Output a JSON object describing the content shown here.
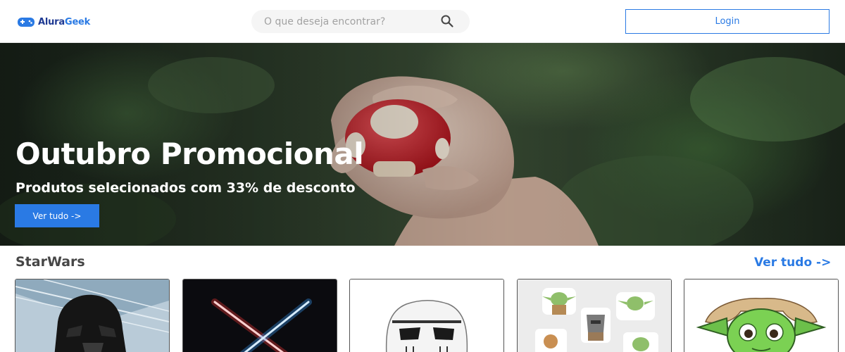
{
  "header": {
    "logo": {
      "name_part1": "Alura",
      "name_part2": "Geek",
      "icon": "gamepad-icon"
    },
    "search": {
      "placeholder": "O que deseja encontrar?",
      "icon": "search-icon"
    },
    "login_label": "Login"
  },
  "hero": {
    "title": "Outubro Promocional",
    "subtitle": "Produtos selecionados com 33% de desconto",
    "button_label": "Ver tudo ->"
  },
  "section": {
    "title": "StarWars",
    "link_label": "Ver tudo ->",
    "products": [
      {
        "image": "darth-vader-helmet"
      },
      {
        "image": "crossed-lightsabers"
      },
      {
        "image": "stormtrooper-helmet"
      },
      {
        "image": "grogu-stickers"
      },
      {
        "image": "yoda-sticker"
      }
    ]
  },
  "colors": {
    "accent": "#2a7ae4",
    "text": "#464646",
    "logo_dark": "#1f3a93"
  }
}
